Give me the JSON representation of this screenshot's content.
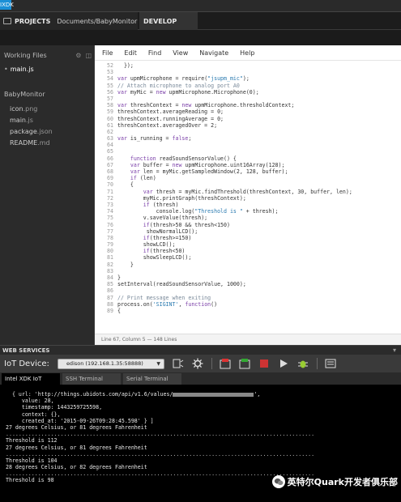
{
  "app": {
    "logo_text": "IXDK",
    "projects_label": "PROJECTS",
    "project_path": "Documents/BabyMonitor",
    "develop_tab": "DEVELOP"
  },
  "sidebar": {
    "title": "Working Files",
    "working_files": [
      {
        "label": "main.js"
      }
    ],
    "folder": "BabyMonitor",
    "files": [
      {
        "name": "icon",
        "ext": ".png"
      },
      {
        "name": "main",
        "ext": ".js"
      },
      {
        "name": "package",
        "ext": ".json"
      },
      {
        "name": "README",
        "ext": ".md"
      }
    ]
  },
  "editor": {
    "menu": [
      "File",
      "Edit",
      "Find",
      "View",
      "Navigate",
      "Help"
    ],
    "lines": [
      {
        "n": "52",
        "c": "  });"
      },
      {
        "n": "53",
        "c": ""
      },
      {
        "n": "54",
        "c": "var upmMicrophone = require(\"jsupm_mic\");"
      },
      {
        "n": "55",
        "c": "// Attach microphone to analog port A0"
      },
      {
        "n": "56",
        "c": "var myMic = new upmMicrophone.Microphone(0);"
      },
      {
        "n": "57",
        "c": ""
      },
      {
        "n": "58",
        "c": "var threshContext = new upmMicrophone.thresholdContext;"
      },
      {
        "n": "59",
        "c": "threshContext.averageReading = 0;"
      },
      {
        "n": "60",
        "c": "threshContext.runningAverage = 0;"
      },
      {
        "n": "61",
        "c": "threshContext.averagedOver = 2;"
      },
      {
        "n": "62",
        "c": ""
      },
      {
        "n": "63",
        "c": "var is_running = false;"
      },
      {
        "n": "64",
        "c": ""
      },
      {
        "n": "65",
        "c": ""
      },
      {
        "n": "66",
        "c": "    function readSoundSensorValue() {"
      },
      {
        "n": "67",
        "c": "    var buffer = new upmMicrophone.uint16Array(128);"
      },
      {
        "n": "68",
        "c": "    var len = myMic.getSampledWindow(2, 128, buffer);"
      },
      {
        "n": "69",
        "c": "    if (len)"
      },
      {
        "n": "70",
        "c": "    {"
      },
      {
        "n": "71",
        "c": "        var thresh = myMic.findThreshold(threshContext, 30, buffer, len);"
      },
      {
        "n": "72",
        "c": "        myMic.printGraph(threshContext);"
      },
      {
        "n": "73",
        "c": "        if (thresh)"
      },
      {
        "n": "74",
        "c": "            console.log(\"Threshold is \" + thresh);"
      },
      {
        "n": "75",
        "c": "        v.saveValue(thresh);"
      },
      {
        "n": "76",
        "c": "        if(thresh>50 && thresh<150)"
      },
      {
        "n": "77",
        "c": "         showNormalLCD();"
      },
      {
        "n": "78",
        "c": "        if(thresh>=150)"
      },
      {
        "n": "79",
        "c": "        showLCD();"
      },
      {
        "n": "80",
        "c": "        if(thresh<50)"
      },
      {
        "n": "81",
        "c": "        showSleepLCD();"
      },
      {
        "n": "82",
        "c": "    }"
      },
      {
        "n": "83",
        "c": ""
      },
      {
        "n": "84",
        "c": "}"
      },
      {
        "n": "85",
        "c": "setInterval(readSoundSensorValue, 1000);"
      },
      {
        "n": "86",
        "c": ""
      },
      {
        "n": "87",
        "c": "// Print message when exiting"
      },
      {
        "n": "88",
        "c": "process.on('SIGINT', function()"
      },
      {
        "n": "89",
        "c": "{"
      }
    ],
    "status": "Line 67, Column 5 — 148 Lines"
  },
  "web_services": {
    "title": "WEB SERVICES"
  },
  "iot": {
    "label": "IoT Device:",
    "device": "edison (192.168.1.35:58888)",
    "tabs": [
      "Intel XDK IoT",
      "SSH Terminal",
      "Serial Terminal"
    ]
  },
  "terminal": {
    "lines": [
      "  { url: 'http://things.ubidots.com/api/v1.6/values/",
      "     value: 28,",
      "     timestamp: 1443259725598,",
      "     context: {},",
      "     created_at: '2015-09-26T09:28:45.598' } ]",
      "27 degrees Celsius, or 81 degrees Fahrenheit",
      "................................................................................................",
      "Threshold is 112",
      "27 degrees Celsius, or 81 degrees Fahrenheit",
      "................................................................................................",
      "Threshold is 104",
      "28 degrees Celsius, or 82 degrees Fahrenheit",
      "................................................................................................",
      "Threshold is 98"
    ],
    "redacted_suffix": "',"
  },
  "watermark": {
    "text": "英特尔Quark开发者俱乐部"
  },
  "colors": {
    "accent": "#1a8fd6",
    "keyword": "#7a3ea8",
    "string": "#2a7ab0",
    "comment": "#7a8a9a"
  }
}
